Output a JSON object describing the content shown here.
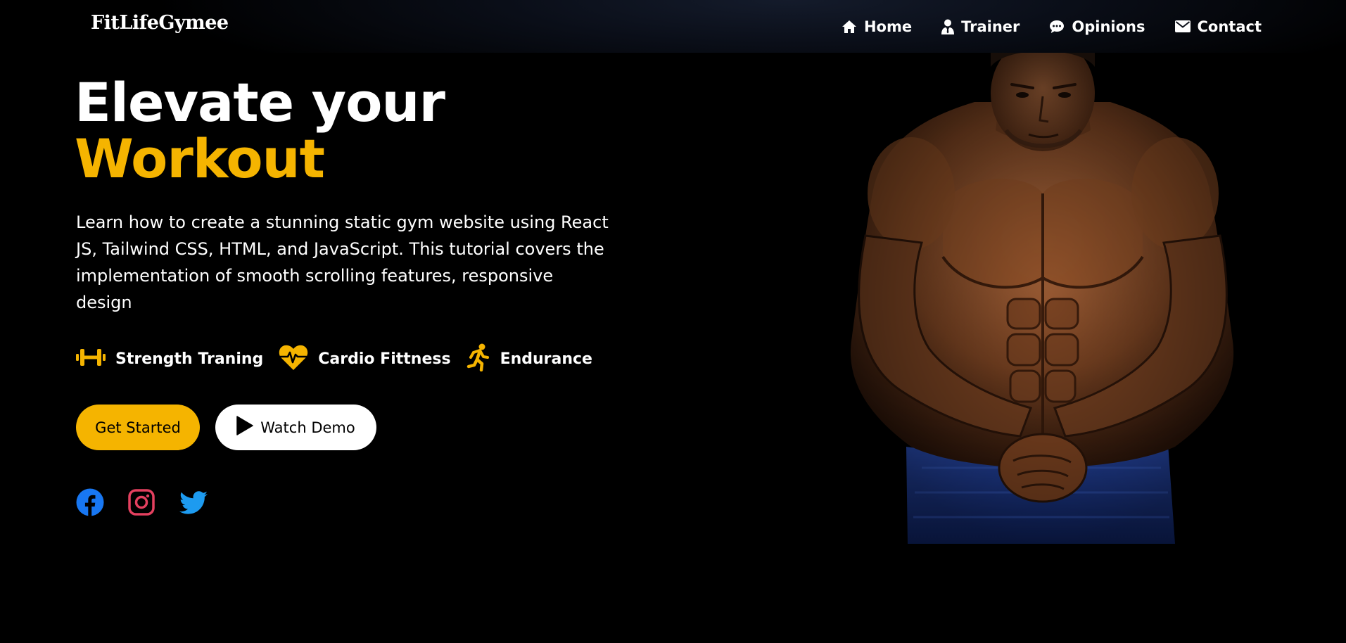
{
  "nav": {
    "brand": "FitLifeGymee",
    "links": [
      {
        "label": "Home",
        "icon": "home-icon"
      },
      {
        "label": "Trainer",
        "icon": "user-tie-icon"
      },
      {
        "label": "Opinions",
        "icon": "comment-icon"
      },
      {
        "label": "Contact",
        "icon": "envelope-icon"
      }
    ]
  },
  "hero": {
    "title_line1": "Elevate your",
    "title_line2": "Workout",
    "description": "Learn how to create a stunning static gym website using React JS, Tailwind CSS, HTML, and JavaScript. This tutorial covers the implementation of smooth scrolling features, responsive design",
    "features": [
      {
        "label": "Strength Traning",
        "icon": "dumbbell-icon"
      },
      {
        "label": "Cardio Fittness",
        "icon": "heartbeat-icon"
      },
      {
        "label": "Endurance",
        "icon": "running-icon"
      }
    ],
    "primary_button": "Get Started",
    "secondary_button": "Watch Demo",
    "socials": [
      {
        "name": "facebook-icon"
      },
      {
        "name": "instagram-icon"
      },
      {
        "name": "twitter-icon"
      }
    ]
  },
  "colors": {
    "accent": "#f5b400",
    "background": "#000000",
    "text": "#ffffff",
    "facebook": "#1877f2",
    "instagram": "#e4405f",
    "twitter": "#1d9bf0"
  }
}
